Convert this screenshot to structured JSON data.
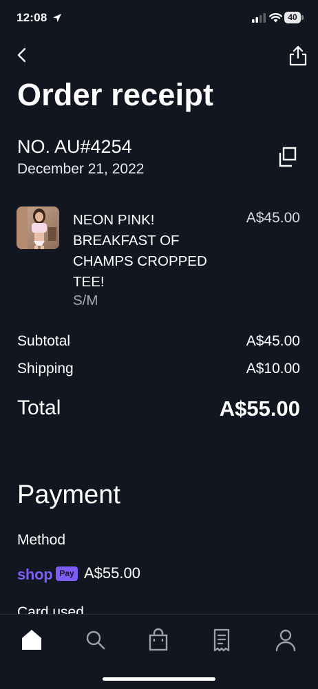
{
  "status_bar": {
    "time": "12:08",
    "battery": "40"
  },
  "header": {
    "title": "Order receipt"
  },
  "order": {
    "number": "NO. AU#4254",
    "date": "December 21, 2022"
  },
  "product": {
    "name": "NEON PINK! BREAKFAST OF CHAMPS CROPPED TEE!",
    "variant": "S/M",
    "price": "A$45.00"
  },
  "summary": {
    "subtotal_label": "Subtotal",
    "subtotal_value": "A$45.00",
    "shipping_label": "Shipping",
    "shipping_value": "A$10.00",
    "total_label": "Total",
    "total_value": "A$55.00"
  },
  "payment": {
    "heading": "Payment",
    "method_label": "Method",
    "provider": "shop",
    "provider_badge": "Pay",
    "amount": "A$55.00",
    "card_used_label": "Card used"
  },
  "colors": {
    "background": "#121620",
    "shop_pay": "#7f5cf5",
    "muted_text": "#a6a9b0"
  },
  "tab_bar": {
    "icons": [
      "home-icon",
      "search-icon",
      "shopping-bag-icon",
      "receipt-icon",
      "account-icon"
    ]
  }
}
